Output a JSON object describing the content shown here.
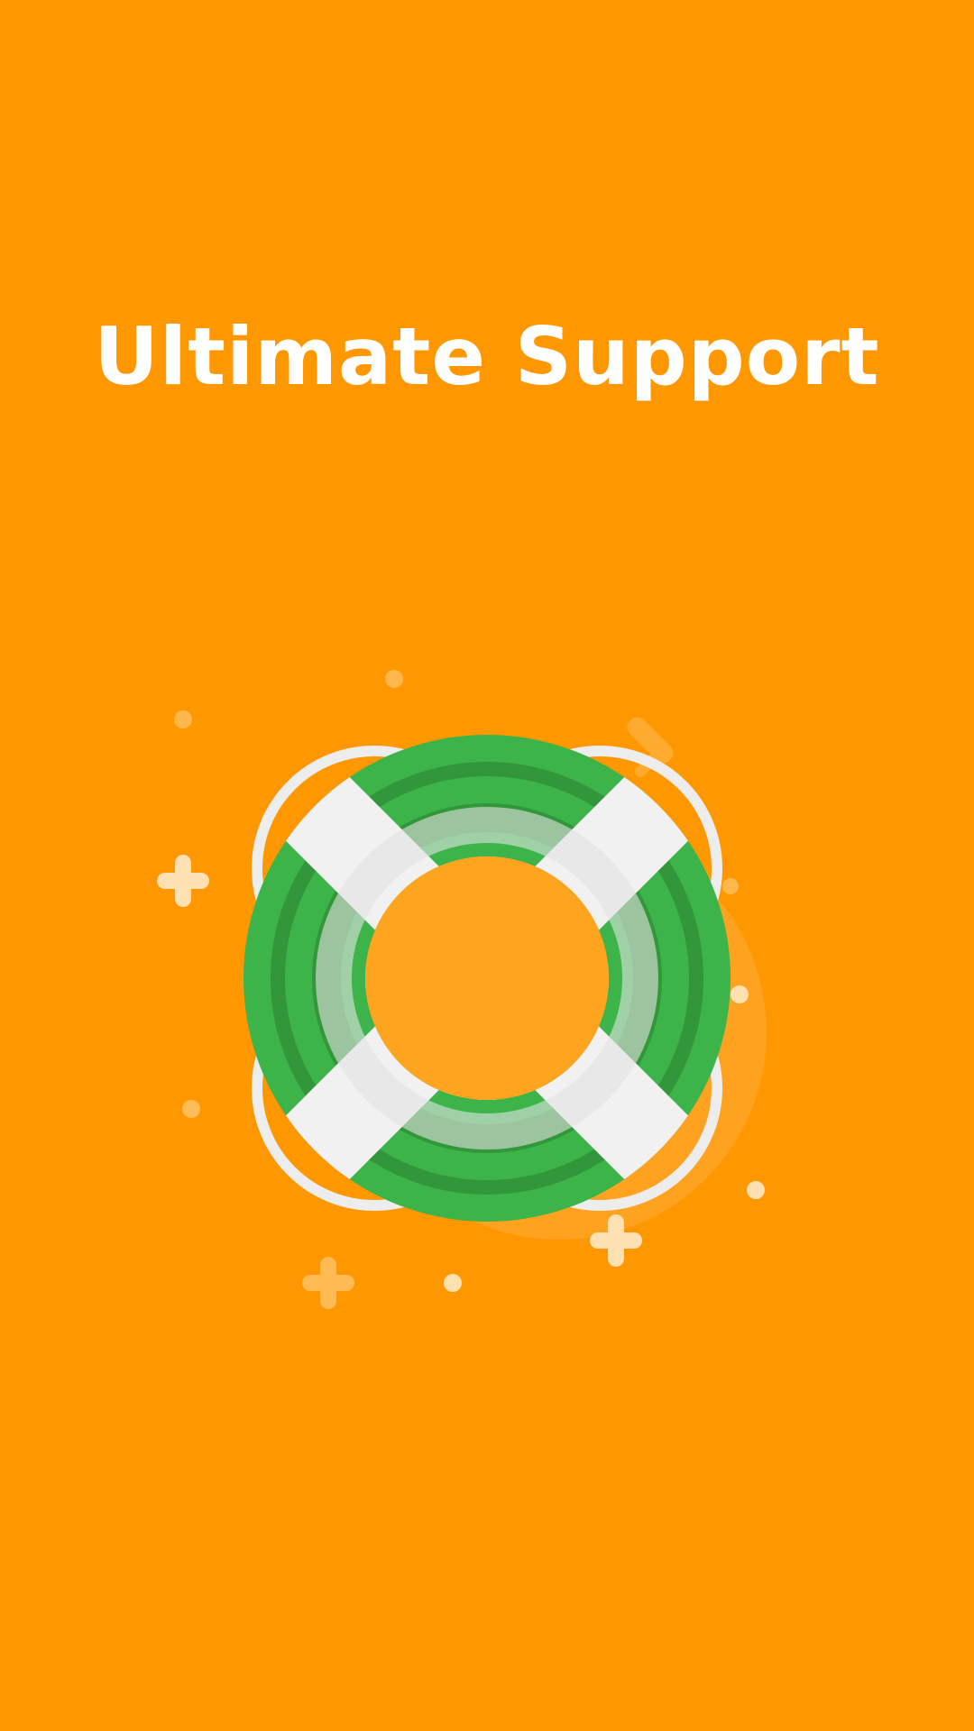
{
  "screen": {
    "background_color": "#FF9800",
    "title": "Ultimate Support"
  },
  "illustration": {
    "icon": "lifebuoy-icon",
    "colors": {
      "ring_green": "#3DB44A",
      "ring_dark_green": "#32963B",
      "stripes_white": "#F1F1F1",
      "center": "#FFA41F",
      "sparkle": "#FFE0B0"
    }
  }
}
